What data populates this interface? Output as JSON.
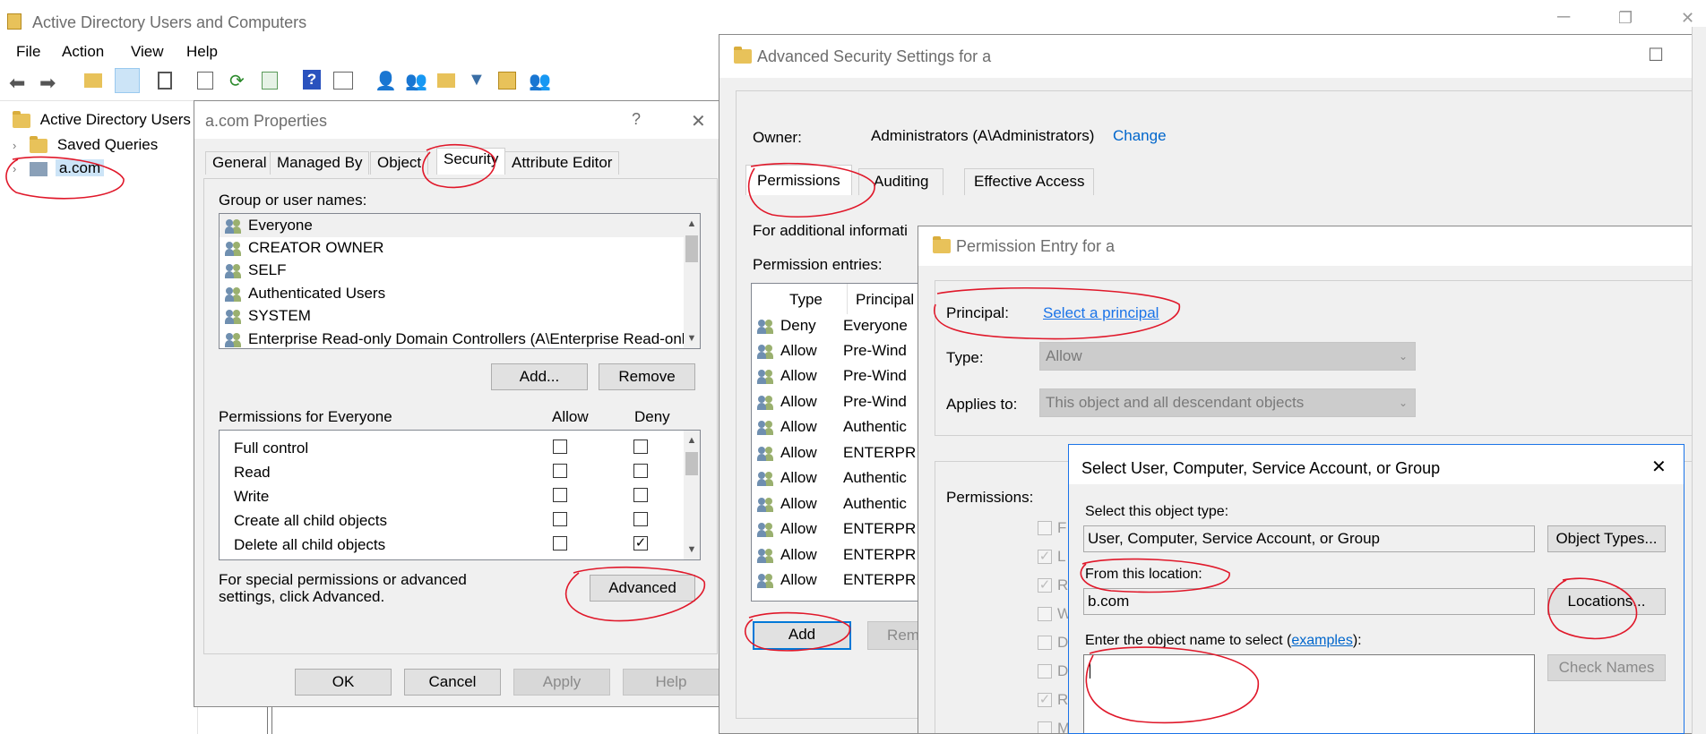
{
  "main_window": {
    "title": "Active Directory Users and Computers",
    "menu": [
      "File",
      "Action",
      "View",
      "Help"
    ],
    "tree": {
      "root": "Active Directory Users",
      "saved_queries": "Saved Queries",
      "domain": "a.com"
    }
  },
  "props_dialog": {
    "title": "a.com Properties",
    "help_glyph": "?",
    "close_glyph": "✕",
    "tabs": [
      "General",
      "Managed By",
      "Object",
      "Security",
      "Attribute Editor"
    ],
    "group_label": "Group or user names:",
    "groups": [
      "Everyone",
      "CREATOR OWNER",
      "SELF",
      "Authenticated Users",
      "SYSTEM",
      "Enterprise Read-only Domain Controllers (A\\Enterprise Read-onl..."
    ],
    "add_btn": "Add...",
    "remove_btn": "Remove",
    "perm_label": "Permissions for Everyone",
    "allow_col": "Allow",
    "deny_col": "Deny",
    "permissions": [
      "Full control",
      "Read",
      "Write",
      "Create all child objects",
      "Delete all child objects"
    ],
    "special_text": "For special permissions or advanced settings, click Advanced.",
    "advanced_btn": "Advanced",
    "ok_btn": "OK",
    "cancel_btn": "Cancel",
    "apply_btn": "Apply",
    "help_btn": "Help"
  },
  "adv_dialog": {
    "title": "Advanced Security Settings for a",
    "owner_label": "Owner:",
    "owner_value": "Administrators (A\\Administrators)",
    "change_link": "Change",
    "tabs": [
      "Permissions",
      "Auditing",
      "Effective Access"
    ],
    "info_text": "For additional informati",
    "entries_label": "Permission entries:",
    "col_type": "Type",
    "col_principal": "Principal",
    "entries": [
      {
        "type": "Deny",
        "principal": "Everyone"
      },
      {
        "type": "Allow",
        "principal": "Pre-Wind"
      },
      {
        "type": "Allow",
        "principal": "Pre-Wind"
      },
      {
        "type": "Allow",
        "principal": "Pre-Wind"
      },
      {
        "type": "Allow",
        "principal": "Authentic"
      },
      {
        "type": "Allow",
        "principal": "ENTERPR"
      },
      {
        "type": "Allow",
        "principal": "Authentic"
      },
      {
        "type": "Allow",
        "principal": "Authentic"
      },
      {
        "type": "Allow",
        "principal": "ENTERPR"
      },
      {
        "type": "Allow",
        "principal": "ENTERPR"
      },
      {
        "type": "Allow",
        "principal": "ENTERPR"
      }
    ],
    "add_btn": "Add",
    "remove_btn_partial": "Rem"
  },
  "entry_dialog": {
    "title": "Permission Entry for a",
    "principal_label": "Principal:",
    "principal_link": "Select a principal",
    "type_label": "Type:",
    "type_value": "Allow",
    "applies_label": "Applies to:",
    "applies_value": "This object and all descendant objects",
    "permissions_label": "Permissions:",
    "perm_letters": [
      "F",
      "L",
      "R",
      "W",
      "D",
      "D",
      "R",
      "M"
    ]
  },
  "select_dialog": {
    "title": "Select User, Computer, Service Account, or Group",
    "close_glyph": "✕",
    "object_type_label": "Select this object type:",
    "object_type_value": "User, Computer, Service Account, or Group",
    "object_types_btn": "Object Types...",
    "location_label": "From this location:",
    "location_value": "b.com",
    "locations_btn": "Locations...",
    "enter_label_pre": "Enter the object name to select (",
    "examples_link": "examples",
    "enter_label_post": "):",
    "check_names_btn": "Check Names"
  }
}
